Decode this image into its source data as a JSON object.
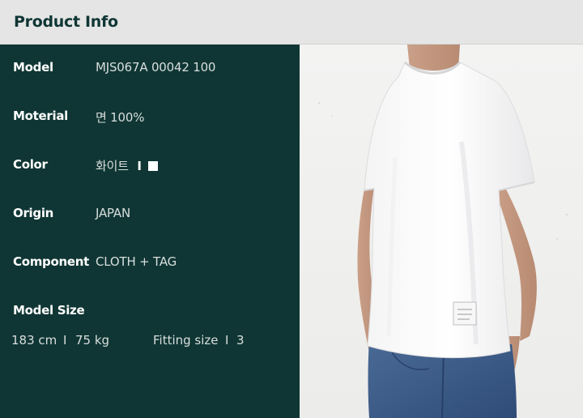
{
  "header": {
    "title": "Product Info"
  },
  "info": {
    "model": {
      "label": "Model",
      "value": "MJS067A 00042 100"
    },
    "material": {
      "label": "Moterial",
      "value": "면 100%"
    },
    "color": {
      "label": "Color",
      "value": "화이트",
      "separator": "I",
      "swatch_color": "#ffffff"
    },
    "origin": {
      "label": "Origin",
      "value": "JAPAN"
    },
    "component": {
      "label": "Component",
      "value": "CLOTH + TAG"
    }
  },
  "model_size": {
    "label": "Model Size",
    "height": "183 cm",
    "sep1": "I",
    "weight": "75 kg",
    "fitting_label": "Fitting size",
    "sep2": "I",
    "fitting_value": "3"
  },
  "colors": {
    "panel_bg": "#0f3634",
    "header_bg": "#e5e5e5",
    "shirt": "#ffffff",
    "jeans": "#3b5a86"
  }
}
